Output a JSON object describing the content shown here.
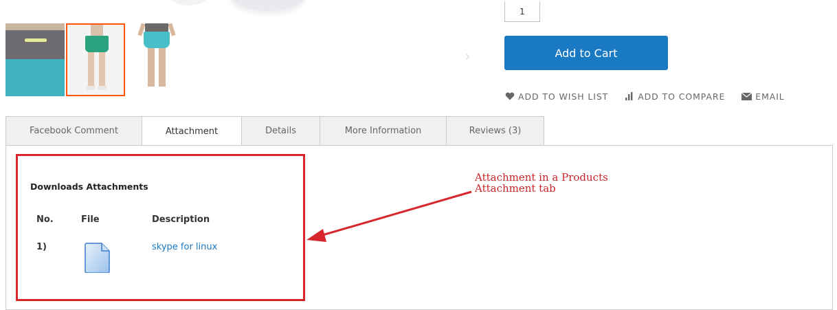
{
  "purchase": {
    "qty_value": "1",
    "add_to_cart_label": "Add to Cart"
  },
  "social_links": [
    {
      "label": "ADD TO WISH LIST",
      "icon": "heart-icon"
    },
    {
      "label": "ADD TO COMPARE",
      "icon": "compare-chart-icon"
    },
    {
      "label": "EMAIL",
      "icon": "envelope-icon"
    }
  ],
  "tabs": [
    {
      "label": "Facebook Comment",
      "active": false
    },
    {
      "label": "Attachment",
      "active": true
    },
    {
      "label": "Details",
      "active": false
    },
    {
      "label": "More Information",
      "active": false
    },
    {
      "label": "Reviews (3)",
      "active": false
    }
  ],
  "attachments": {
    "title": "Downloads Attachments",
    "columns": {
      "no": "No.",
      "file": "File",
      "description": "Description"
    },
    "rows": [
      {
        "no": "1)",
        "file_icon": "document-icon",
        "description": "skype for linux"
      }
    ]
  },
  "annotation": {
    "line1": "Attachment in a Products",
    "line2": "Attachment tab"
  },
  "colors": {
    "accent": "#1979c3",
    "annotation": "#d8262d",
    "thumb_active_border": "#ff5501"
  }
}
